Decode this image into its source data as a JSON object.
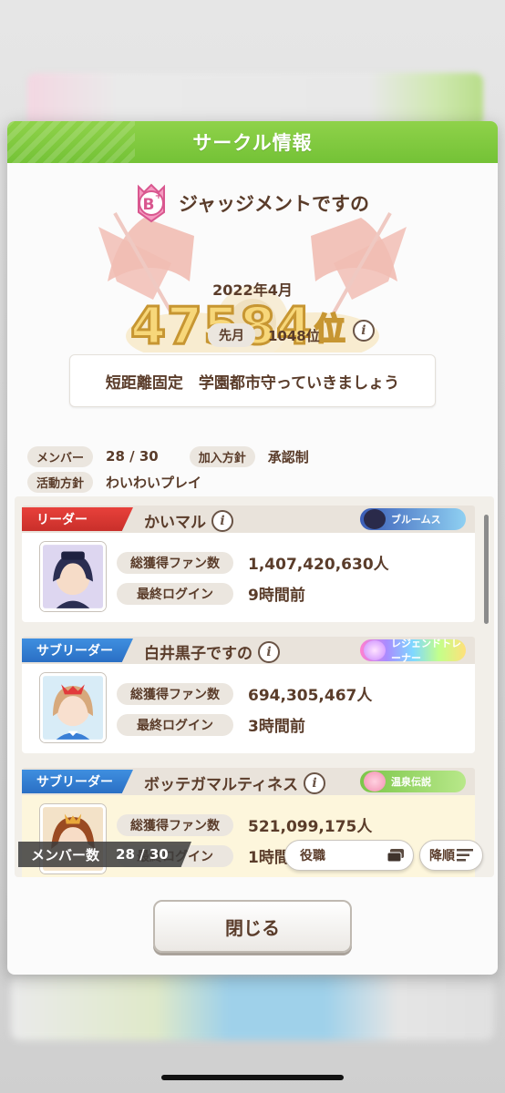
{
  "modal": {
    "title": "サークル情報",
    "circle_name": "ジャッジメントですの",
    "rank_badge": "B+",
    "rank_period": "2022年4月",
    "rank_number": "47584",
    "rank_suffix": "位",
    "last_month_label": "先月",
    "last_month_value": "1048位",
    "description": "短距離固定　学園都市守っていきましょう",
    "meta": {
      "members_label": "メンバー",
      "members_value": "28 / 30",
      "join_policy_label": "加入方針",
      "join_policy_value": "承認制",
      "activity_label": "活動方針",
      "activity_value": "わいわいプレイ"
    }
  },
  "members": [
    {
      "role": "リーダー",
      "name": "かいマル",
      "title_badge": "ブルームス",
      "fans_label": "総獲得ファン数",
      "fans_value": "1,407,420,630人",
      "login_label": "最終ログイン",
      "login_value": "9時間前"
    },
    {
      "role": "サブリーダー",
      "name": "白井黒子ですの",
      "title_badge": "レジェンドトレーナー",
      "fans_label": "総獲得ファン数",
      "fans_value": "694,305,467人",
      "login_label": "最終ログイン",
      "login_value": "3時間前"
    },
    {
      "role": "サブリーダー",
      "name": "ボッテガマルティネス",
      "title_badge": "温泉伝説",
      "fans_label": "総獲得ファン数",
      "fans_value": "521,099,175人",
      "login_label": "最終ログイン",
      "login_value": "1時間"
    }
  ],
  "controls": {
    "member_count_label": "メンバー数",
    "member_count_value": "28 / 30",
    "role_button": "役職",
    "sort_button": "降順",
    "close_button": "閉じる"
  },
  "colors": {
    "header_green": "#7fc93e",
    "leader_red": "#e0382f",
    "subleader_blue": "#3583d8",
    "text_brown": "#5a3c2a",
    "rank_gold": "#f7d77a"
  },
  "icons": {
    "info": "info-icon",
    "role_menu": "card-stack-icon",
    "sort": "sort-lines-icon"
  }
}
